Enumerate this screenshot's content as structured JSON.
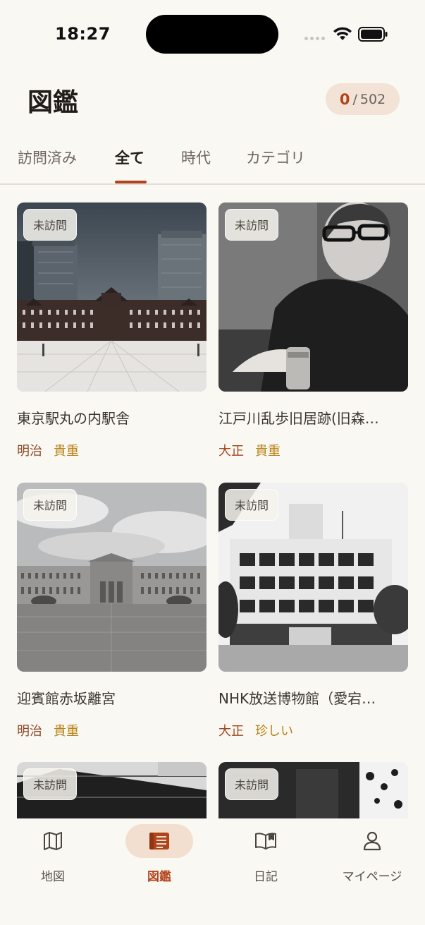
{
  "status_bar": {
    "time": "18:27"
  },
  "header": {
    "title": "図鑑",
    "visited_count": "0",
    "separator": "/",
    "total_count": "502"
  },
  "tabs": [
    {
      "label": "訪問済み"
    },
    {
      "label": "全て"
    },
    {
      "label": "時代"
    },
    {
      "label": "カテゴリ"
    }
  ],
  "active_tab": "全て",
  "cards": [
    {
      "badge": "未訪問",
      "name": "東京駅丸の内駅舎",
      "era": "明治",
      "rarity": "貴重"
    },
    {
      "badge": "未訪問",
      "name": "江戸川乱歩旧居跡(旧森…",
      "era": "大正",
      "rarity": "貴重"
    },
    {
      "badge": "未訪問",
      "name": "迎賓館赤坂離宮",
      "era": "明治",
      "rarity": "貴重"
    },
    {
      "badge": "未訪問",
      "name": "NHK放送博物館（愛宕…",
      "era": "大正",
      "rarity": "珍しい"
    },
    {
      "badge": "未訪問"
    },
    {
      "badge": "未訪問"
    }
  ],
  "bottom_nav": [
    {
      "label": "地図",
      "icon": "map-icon"
    },
    {
      "label": "図鑑",
      "icon": "book-icon",
      "active": true
    },
    {
      "label": "日記",
      "icon": "open-book-icon"
    },
    {
      "label": "マイページ",
      "icon": "person-icon"
    }
  ],
  "colors": {
    "background": "#faf8f3",
    "accent": "#b2441c",
    "accent_soft": "#f3dfcf",
    "era_text": "#8a4a27",
    "rarity_text": "#b88318"
  }
}
